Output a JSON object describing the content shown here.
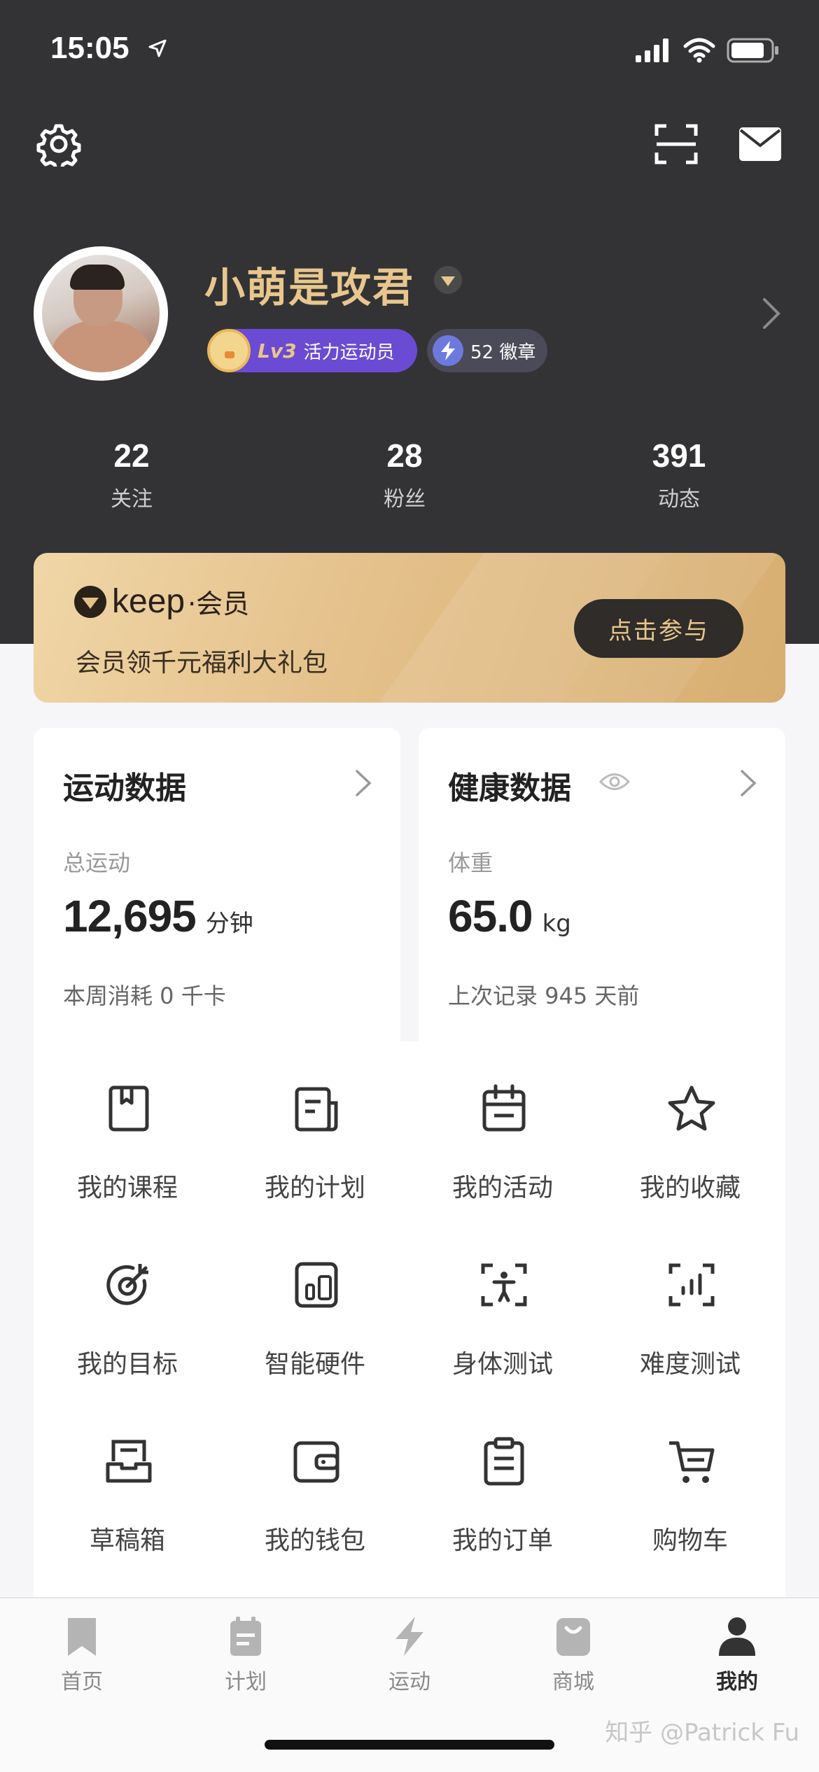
{
  "status_bar": {
    "time": "15:05"
  },
  "profile": {
    "username": "小萌是攻君",
    "level": "Lv3",
    "level_title": "活力运动员",
    "badges_text": "52 徽章"
  },
  "stats": [
    {
      "value": "22",
      "label": "关注"
    },
    {
      "value": "28",
      "label": "粉丝"
    },
    {
      "value": "391",
      "label": "动态"
    }
  ],
  "vip": {
    "brand": "keep",
    "brand_suffix": "·会员",
    "description": "会员领千元福利大礼包",
    "button_label": "点击参与",
    "colors": {
      "gold": "#e8c68d",
      "card_start": "#f0d6a7",
      "card_end": "#d7ae71"
    }
  },
  "sport_data": {
    "title": "运动数据",
    "sub_label": "总运动",
    "value": "12,695",
    "unit": "分钟",
    "footer": "本周消耗 0 千卡"
  },
  "health_data": {
    "title": "健康数据",
    "sub_label": "体重",
    "value": "65.0",
    "unit": "kg",
    "footer": "上次记录 945 天前"
  },
  "grid": [
    {
      "label": "我的课程",
      "icon": "bookmark-book-icon"
    },
    {
      "label": "我的计划",
      "icon": "plan-document-icon"
    },
    {
      "label": "我的活动",
      "icon": "calendar-icon"
    },
    {
      "label": "我的收藏",
      "icon": "star-icon"
    },
    {
      "label": "我的目标",
      "icon": "target-icon"
    },
    {
      "label": "智能硬件",
      "icon": "devices-icon"
    },
    {
      "label": "身体测试",
      "icon": "body-scan-icon"
    },
    {
      "label": "难度测试",
      "icon": "difficulty-scan-icon"
    },
    {
      "label": "草稿箱",
      "icon": "draft-tray-icon"
    },
    {
      "label": "我的钱包",
      "icon": "wallet-icon"
    },
    {
      "label": "我的订单",
      "icon": "clipboard-icon"
    },
    {
      "label": "购物车",
      "icon": "cart-icon"
    }
  ],
  "tabbar": [
    {
      "label": "首页",
      "icon": "bookmark-icon"
    },
    {
      "label": "计划",
      "icon": "calendar-icon"
    },
    {
      "label": "运动",
      "icon": "lightning-icon"
    },
    {
      "label": "商城",
      "icon": "shopping-bag-icon"
    },
    {
      "label": "我的",
      "icon": "person-icon",
      "active": true
    }
  ],
  "watermark": "知乎 @Patrick Fu"
}
